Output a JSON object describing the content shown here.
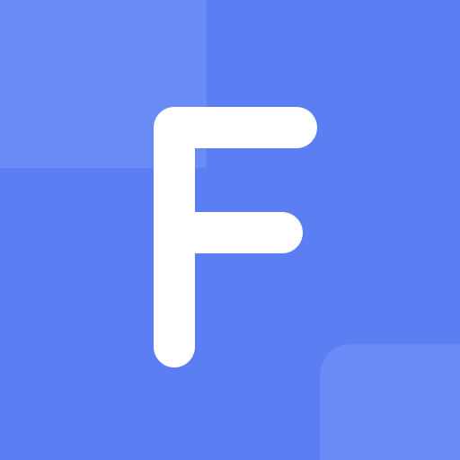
{
  "icon": {
    "name": "letter-f-app-icon",
    "letter": "F",
    "colors": {
      "background": "#5b7ff3",
      "accent_tile": "#6a8bf6",
      "letter": "#ffffff"
    }
  }
}
